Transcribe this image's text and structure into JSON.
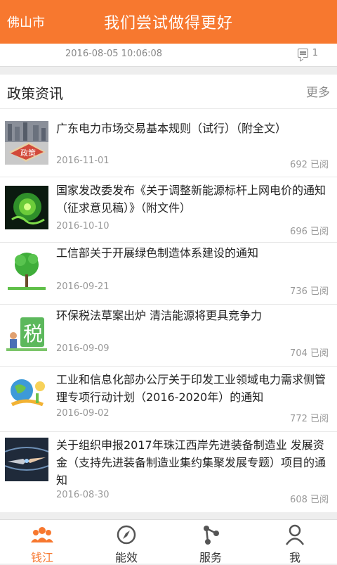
{
  "header": {
    "city": "佛山市",
    "title": "我们尝试做得更好"
  },
  "meta_bar": {
    "timestamp": "2016-08-05 10:06:08",
    "comment_count": "1"
  },
  "section": {
    "title": "政策资讯",
    "more_label": "更多"
  },
  "news": [
    {
      "title": "广东电力市场交易基本规则（试行）（附全文）",
      "date": "2016-11-01",
      "reads": "692 已阅",
      "thumb_icon": "policy-book-thumbnail"
    },
    {
      "title": "国家发改委发布《关于调整新能源标杆上网电价的通知（征求意见稿）》（附文件）",
      "date": "2016-10-10",
      "reads": "696 已阅",
      "thumb_icon": "green-energy-thumbnail"
    },
    {
      "title": "工信部关于开展绿色制造体系建设的通知",
      "date": "2016-09-21",
      "reads": "736 已阅",
      "thumb_icon": "green-tree-thumbnail"
    },
    {
      "title": "环保税法草案出炉 清洁能源将更具竞争力",
      "date": "2016-09-09",
      "reads": "704 已阅",
      "thumb_icon": "tax-character-thumbnail"
    },
    {
      "title": "工业和信息化部办公厅关于印发工业领域电力需求侧管理专项行动计划（2016-2020年）的通知",
      "date": "2016-09-02",
      "reads": "772 已阅",
      "thumb_icon": "globe-energy-thumbnail"
    },
    {
      "title": "关于组织申报2017年珠江西岸先进装备制造业 发展资金（支持先进装备制造业集约集聚发展专题）项目的通知",
      "date": "2016-08-30",
      "reads": "608 已阅",
      "thumb_icon": "robot-hand-thumbnail"
    }
  ],
  "tabs": [
    {
      "label": "钱江",
      "icon": "people-icon",
      "active": true
    },
    {
      "label": "能效",
      "icon": "compass-icon",
      "active": false
    },
    {
      "label": "服务",
      "icon": "share-nodes-icon",
      "active": false
    },
    {
      "label": "我",
      "icon": "user-icon",
      "active": false
    }
  ],
  "colors": {
    "accent": "#f7782f",
    "text": "#222222",
    "muted": "#999999"
  }
}
